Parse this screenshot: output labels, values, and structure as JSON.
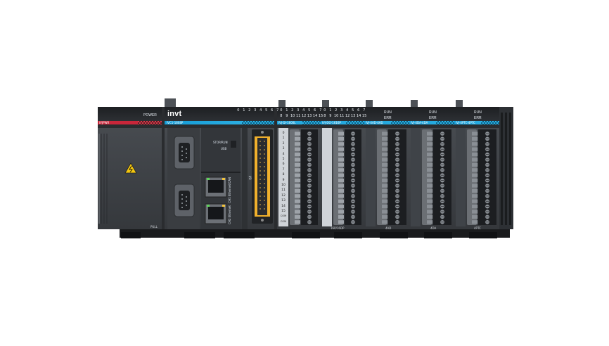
{
  "power_module": {
    "title": "POWER",
    "model": "IVJPWR",
    "pull_label": "PULL"
  },
  "cpu_module": {
    "brand": "invt",
    "model": "IVC1-1808P",
    "switch_label": "STOP/RUN",
    "usb_label": "USB",
    "port_top_label": "CH1 Ethernet/CAN",
    "port_bottom_label": "CH2 Ethernet",
    "io_label": "I/O",
    "led_digits": [
      "0",
      "1",
      "2",
      "3",
      "4",
      "5",
      "6",
      "7"
    ]
  },
  "input_module": {
    "model": "IVJ-DI-1600L",
    "row_top": [
      "0",
      "1",
      "2",
      "3",
      "4",
      "5",
      "6",
      "7"
    ],
    "row_bottom": [
      "8",
      "9",
      "10",
      "11",
      "12",
      "13",
      "14",
      "15"
    ],
    "terminals": [
      "0",
      "1",
      "2",
      "3",
      "4",
      "5",
      "6",
      "7",
      "8",
      "9",
      "10",
      "11",
      "12",
      "13",
      "14",
      "15",
      "COM",
      "COM"
    ]
  },
  "output_module": {
    "model": "IVJ-DO-1616P",
    "row_top": [
      "0",
      "1",
      "2",
      "3",
      "4",
      "5",
      "6",
      "7"
    ],
    "row_bottom": [
      "8",
      "9",
      "10",
      "11",
      "12",
      "13",
      "14",
      "15"
    ],
    "footer": "16P/16DP"
  },
  "analog_modules": [
    {
      "model": "IVJ-4AD-4AD",
      "run": "RUN",
      "err": "ERR",
      "footer": "4AD"
    },
    {
      "model": "IVJ-4DA-4DA",
      "run": "RUN",
      "err": "ERR",
      "footer": "4DA"
    },
    {
      "model": "IVJ-4PTC-4PTC",
      "run": "RUN",
      "err": "ERR",
      "footer": "4PTC"
    }
  ],
  "colors": {
    "housing": "#3c3f43",
    "housing_dark": "#26282b",
    "accent_red": "#c9263a",
    "accent_blue": "#1aa3d8",
    "label_light": "#d9dde1"
  }
}
